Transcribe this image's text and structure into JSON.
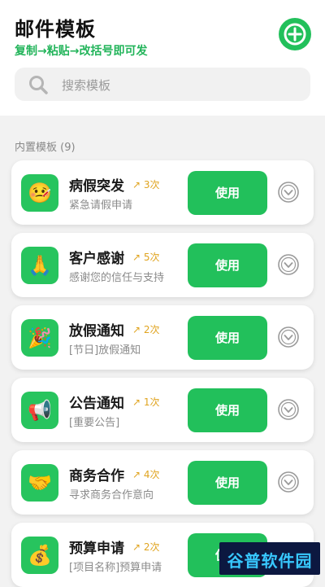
{
  "header": {
    "title": "邮件模板",
    "subtitle": "复制→粘贴→改括号即可发",
    "add_icon": "plus-circle-icon",
    "accent_color": "#22c05b"
  },
  "search": {
    "placeholder": "搜索模板",
    "icon": "search-icon"
  },
  "section": {
    "title": "内置模板 (9)"
  },
  "templates": [
    {
      "name": "病假突发",
      "count": "↗ 3次",
      "desc": "紧急请假申请",
      "emoji": "🤒",
      "use_label": "使用"
    },
    {
      "name": "客户感谢",
      "count": "↗ 5次",
      "desc": "感谢您的信任与支持",
      "emoji": "🙏",
      "use_label": "使用"
    },
    {
      "name": "放假通知",
      "count": "↗ 2次",
      "desc": "[节日]放假通知",
      "emoji": "🎉",
      "use_label": "使用"
    },
    {
      "name": "公告通知",
      "count": "↗ 1次",
      "desc": "[重要公告]",
      "emoji": "📢",
      "use_label": "使用"
    },
    {
      "name": "商务合作",
      "count": "↗ 4次",
      "desc": "寻求商务合作意向",
      "emoji": "🤝",
      "use_label": "使用"
    },
    {
      "name": "预算申请",
      "count": "↗ 2次",
      "desc": "[项目名称]预算申请",
      "emoji": "💰",
      "use_label": "使用"
    }
  ],
  "watermark": {
    "text": "谷普软件园"
  }
}
